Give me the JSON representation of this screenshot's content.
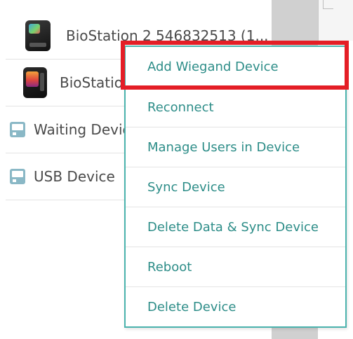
{
  "device_list": {
    "items": [
      {
        "label": "BioStation 2 546832513 (1...",
        "icon": "biostation-2-device-icon"
      },
      {
        "label": "BioStation",
        "icon": "biostation-a2-device-icon"
      },
      {
        "label": "Waiting Device",
        "icon": "folder-device-icon"
      },
      {
        "label": "USB Device",
        "icon": "folder-device-icon"
      }
    ]
  },
  "context_menu": {
    "items": [
      {
        "label": "Add Wiegand Device",
        "highlighted": true
      },
      {
        "label": "Reconnect"
      },
      {
        "label": "Manage Users in Device"
      },
      {
        "label": "Sync Device"
      },
      {
        "label": "Delete Data & Sync Device"
      },
      {
        "label": "Reboot"
      },
      {
        "label": "Delete Device"
      }
    ],
    "accent_color": "#4bb3ad",
    "text_color": "#2d8d88",
    "highlight_color": "#e41e26"
  }
}
